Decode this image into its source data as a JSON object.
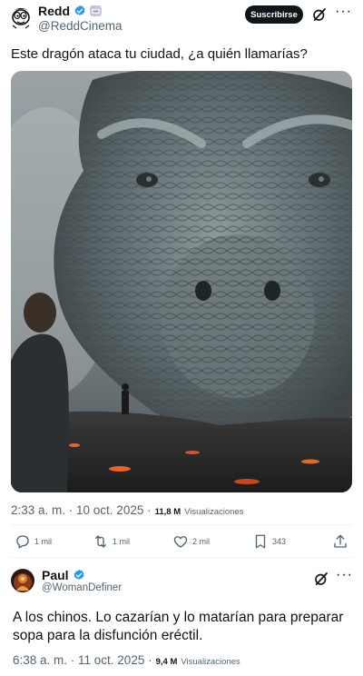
{
  "post": {
    "author_name": "Redd",
    "author_handle": "@ReddCinema",
    "subscribe_label": "Suscribirse",
    "text": "Este dragón ataca tu ciudad, ¿a quién llamarías?",
    "timestamp": "2:33 a. m. · 10 oct. 2025 ·",
    "views_count": "11,8 M",
    "views_label": "Visualizaciones",
    "icons": [
      "cartoon-avatar",
      "verified-badge-icon",
      "affiliate-badge-icon",
      "grok-icon",
      "more-icon"
    ]
  },
  "actions": {
    "replies": "1 mil",
    "reposts": "1 mil",
    "likes": "2 mil",
    "bookmarks": "343",
    "icons": [
      "reply-icon",
      "repost-icon",
      "like-icon",
      "bookmark-icon",
      "share-icon"
    ]
  },
  "reply": {
    "author_name": "Paul",
    "author_handle": "@WomanDefiner",
    "text": "A los chinos. Lo cazarían y lo matarían para preparar sopa para la disfunción eréctil.",
    "timestamp": "6:38 a. m. · 11 oct. 2025 ·",
    "views_count": "9,4 M",
    "views_label": "Visualizaciones"
  },
  "colors": {
    "text": "#0f1419",
    "secondary": "#536471",
    "verified": "#1d9bf0",
    "divider": "#eff3f4",
    "button": "#0f1419"
  }
}
